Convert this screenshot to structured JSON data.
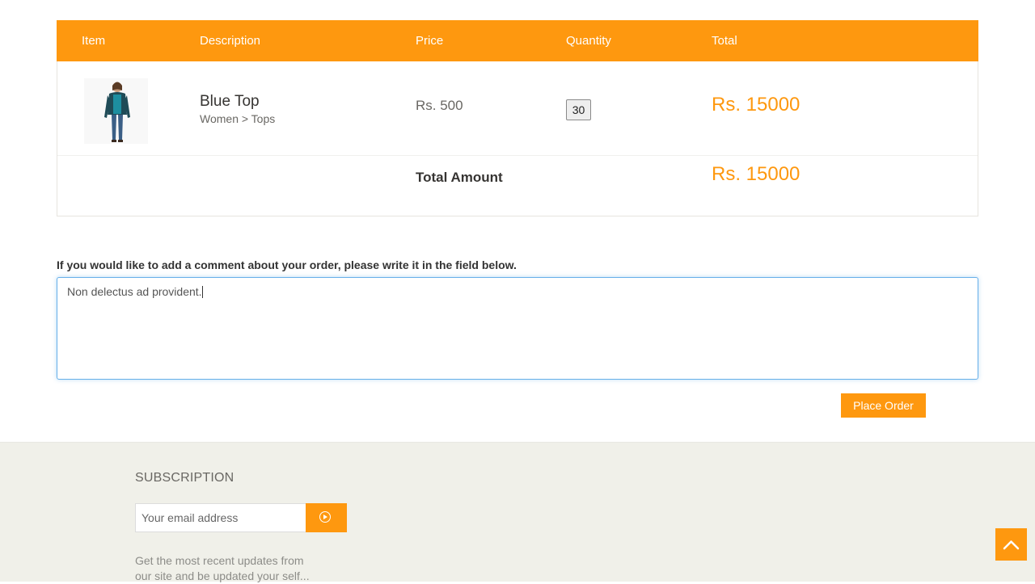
{
  "cart": {
    "headers": [
      "Item",
      "Description",
      "Price",
      "Quantity",
      "Total"
    ],
    "items": [
      {
        "name": "Blue Top",
        "category": "Women > Tops",
        "price": "Rs. 500",
        "quantity": "30",
        "total": "Rs. 15000"
      }
    ],
    "total_label": "Total Amount",
    "total_amount": "Rs. 15000"
  },
  "comment": {
    "label": "If you would like to add a comment about your order, please write it in the field below.",
    "value": "Non delectus ad provident."
  },
  "place_order_label": "Place Order",
  "footer": {
    "subscription_title": "SUBSCRIPTION",
    "email_placeholder": "Your email address",
    "subscription_text": "Get the most recent updates from our site and be updated your self..."
  },
  "colors": {
    "accent": "#FE980F",
    "footer_bg": "#f0f0e9"
  }
}
